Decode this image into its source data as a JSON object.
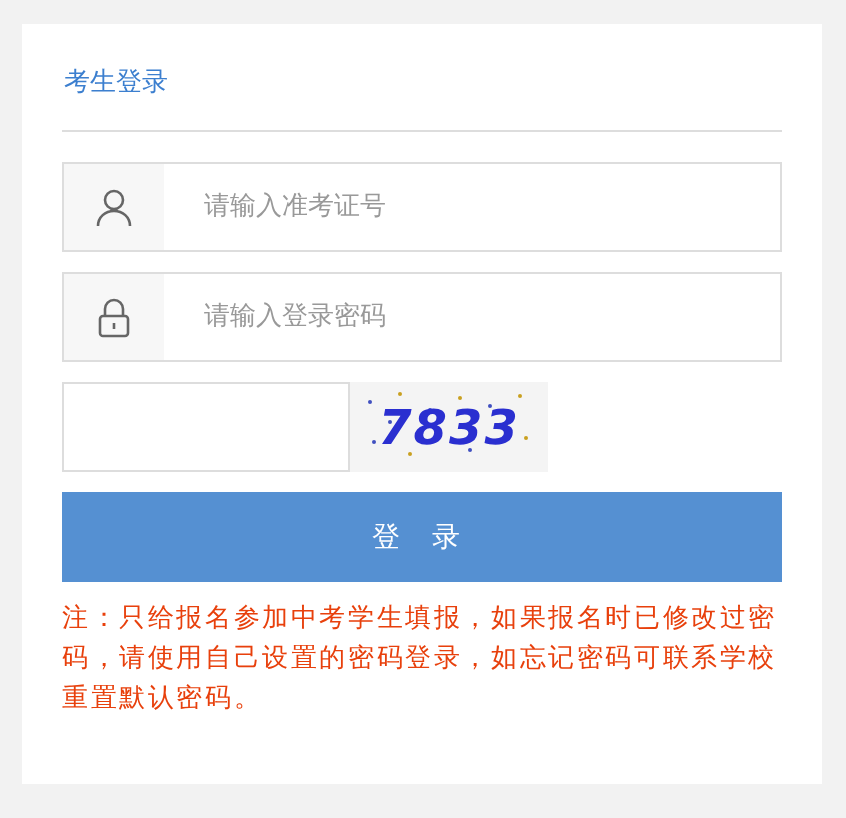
{
  "title": "考生登录",
  "fields": [
    {
      "kind": "user",
      "placeholder": "请输入准考证号"
    },
    {
      "kind": "lock",
      "placeholder": "请输入登录密码"
    }
  ],
  "captcha": {
    "code": "7833"
  },
  "button": "登 录",
  "note": "注：只给报名参加中考学生填报，如果报名时已修改过密码，请使用自己设置的密码登录，如忘记密码可联系学校重置默认密码。"
}
